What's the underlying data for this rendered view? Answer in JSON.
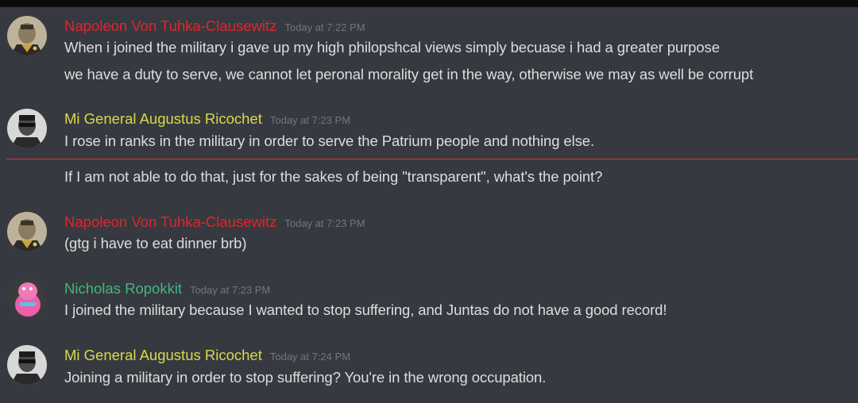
{
  "colors": {
    "background": "#36393f",
    "napoleon": "#e0252c",
    "ricochet": "#d8d94a",
    "nicholas": "#43b581",
    "timestamp": "#72767d",
    "text": "#dcddde",
    "new_divider": "#c43b3b"
  },
  "messages": [
    {
      "author": "Napoleon Von Tuhka-Clausewitz",
      "timestamp": "Today at 7:22 PM",
      "lines": [
        "When i joined the military i gave up my high philopshcal views simply becuase i had a greater purpose",
        "we have a duty to serve, we cannot let peronal morality get in the way, otherwise we may as well be corrupt"
      ]
    },
    {
      "author": "Mi General Augustus Ricochet",
      "timestamp": "Today at 7:23 PM",
      "lines": [
        "I rose in ranks in the military in order to serve the Patrium people and nothing else.",
        "If I am not able to do that, just for the sakes of being \"transparent\", what's the point?"
      ]
    },
    {
      "author": "Napoleon Von Tuhka-Clausewitz",
      "timestamp": "Today at 7:23 PM",
      "lines": [
        "(gtg i have to eat dinner brb)"
      ]
    },
    {
      "author": "Nicholas Ropokkit",
      "timestamp": "Today at 7:23 PM",
      "lines": [
        "I joined the military because I wanted to stop suffering, and Juntas do not have a good record!"
      ]
    },
    {
      "author": "Mi General Augustus Ricochet",
      "timestamp": "Today at 7:24 PM",
      "lines": [
        "Joining a military in order to stop suffering? You're in the wrong occupation."
      ]
    }
  ]
}
